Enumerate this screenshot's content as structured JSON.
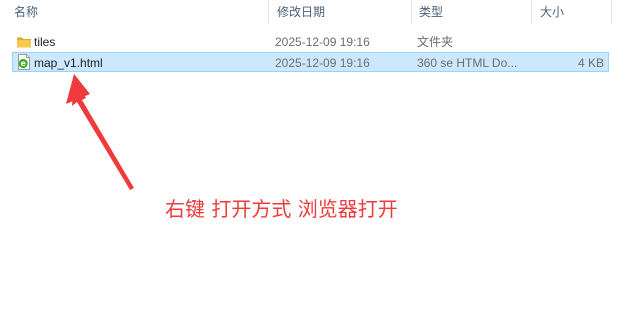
{
  "columns": {
    "name": "名称",
    "modified": "修改日期",
    "type": "类型",
    "size": "大小"
  },
  "files": [
    {
      "name": "tiles",
      "modified": "2025-12-09 19:16",
      "type": "文件夹",
      "size": "",
      "icon": "folder-icon",
      "selected": false
    },
    {
      "name": "map_v1.html",
      "modified": "2025-12-09 19:16",
      "type": "360 se HTML Do...",
      "size": "4 KB",
      "icon": "html-file-icon",
      "selected": true
    }
  ],
  "annotation": {
    "text": "右键 打开方式 浏览器打开",
    "color": "#ef3b3b"
  },
  "colors": {
    "selection_bg": "#cce8ff",
    "selection_border": "#99d1ff",
    "header_text": "#4c607a",
    "folder": "#e8b83a"
  }
}
